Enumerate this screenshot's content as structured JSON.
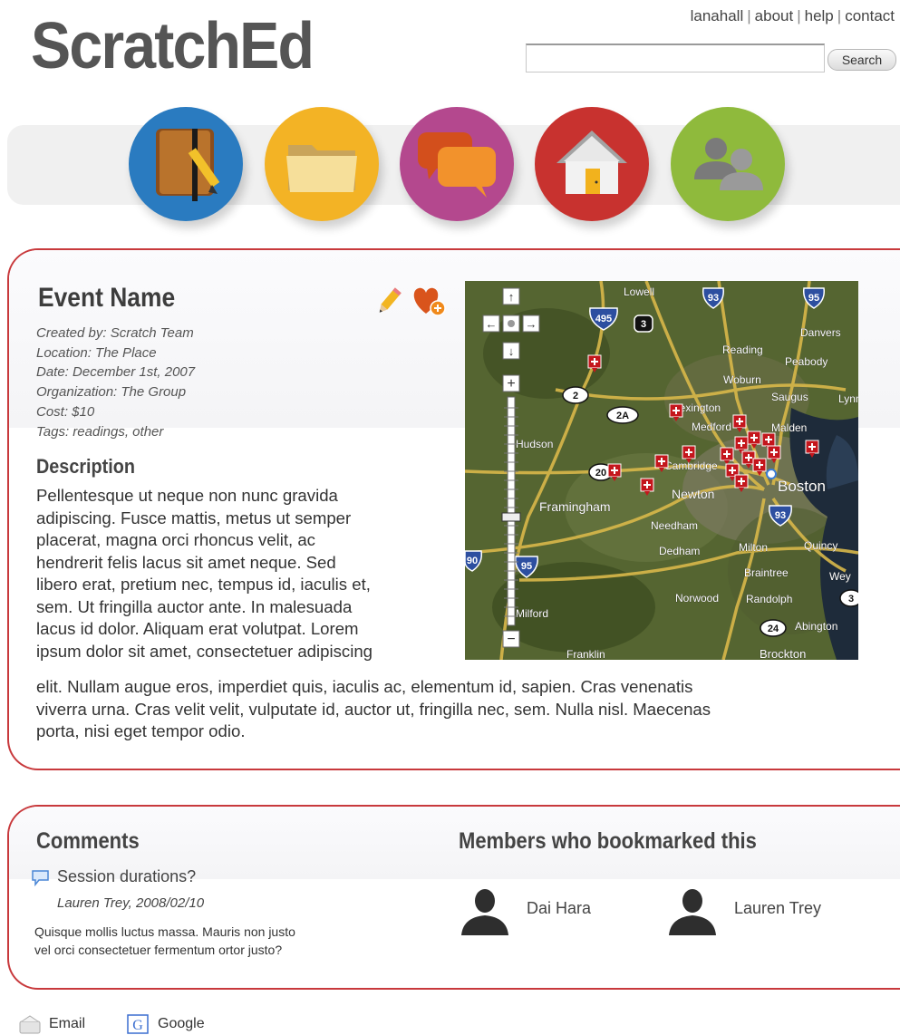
{
  "header": {
    "logo": "ScratchEd",
    "links": [
      "lanahall",
      "about",
      "help",
      "contact"
    ],
    "search_placeholder": "",
    "search_button": "Search"
  },
  "nav": {
    "icons": [
      {
        "name": "notebook-icon",
        "color": "#2a7bc0"
      },
      {
        "name": "folder-icon",
        "color": "#f3b325"
      },
      {
        "name": "chat-icon",
        "color": "#b4488e"
      },
      {
        "name": "home-icon",
        "color": "#c8322f"
      },
      {
        "name": "people-icon",
        "color": "#8fba3c"
      }
    ]
  },
  "event": {
    "name": "Event Name",
    "created_by": "Created by: Scratch Team",
    "location": "Location: The Place",
    "date": "Date: December 1st, 2007",
    "organization": "Organization: The Group",
    "cost": "Cost: $10",
    "tags": "Tags: readings, other",
    "description_heading": "Description",
    "description_lines": [
      "Pellentesque ut neque non nunc gravida",
      "adipiscing. Fusce mattis, metus ut semper",
      "placerat, magna orci rhoncus velit, ac",
      "hendrerit felis lacus sit amet neque. Sed",
      "libero erat, pretium nec, tempus id, iaculis et,",
      "sem. Ut fringilla auctor ante. In malesuada",
      "lacus id dolor. Aliquam erat volutpat. Lorem",
      "ipsum dolor sit amet, consectetuer adipiscing"
    ],
    "description_wide_lines": [
      "elit. Nullam augue eros, imperdiet quis, iaculis ac, elementum id, sapien. Cras venenatis",
      "viverra urna. Cras velit velit, vulputate id, auctor ut, fringilla nec, sem. Nulla nisl. Maecenas",
      "porta, nisi eget tempor odio."
    ]
  },
  "map": {
    "labels": {
      "lowell": "Lowell",
      "reading": "Reading",
      "peabody": "Peabody",
      "danvers": "Danvers",
      "woburn": "Woburn",
      "saugus": "Saugus",
      "lynn": "Lynn",
      "lexington": "Lexington",
      "medford": "Medford",
      "malden": "Malden",
      "hudson": "Hudson",
      "framingham": "Framingham",
      "newton": "Newton",
      "boston": "Boston",
      "needham": "Needham",
      "dedham": "Dedham",
      "milton": "Milton",
      "quincy": "Quincy",
      "braintree": "Braintree",
      "norwood": "Norwood",
      "randolph": "Randolph",
      "milford": "Milford",
      "abington": "Abington",
      "brockton": "Brockton",
      "franklin": "Franklin",
      "cambridge": "Cambridge",
      "weymouth": "Wey"
    },
    "shields": {
      "i495": "495",
      "r3": "3",
      "i93": "93",
      "i95": "95",
      "r2": "2",
      "r2a": "2A",
      "r20": "20",
      "i90": "90",
      "i95s": "95",
      "i93s": "93",
      "r3s": "3",
      "r24": "24"
    },
    "controls": {
      "up": "↑",
      "down": "↓",
      "left": "←",
      "right": "→",
      "zoom_in": "+",
      "zoom_out": "−"
    }
  },
  "comments": {
    "heading": "Comments",
    "items": [
      {
        "title": "Session durations?",
        "meta": "Lauren Trey, 2008/02/10",
        "body_lines": [
          "Quisque mollis luctus massa. Mauris non justo",
          "vel orci consectetuer fermentum ortor justo?"
        ]
      }
    ]
  },
  "members": {
    "heading": "Members who bookmarked this",
    "items": [
      {
        "name": "Dai Hara"
      },
      {
        "name": "Lauren Trey"
      }
    ]
  },
  "share": {
    "email": "Email",
    "google": "Google"
  }
}
